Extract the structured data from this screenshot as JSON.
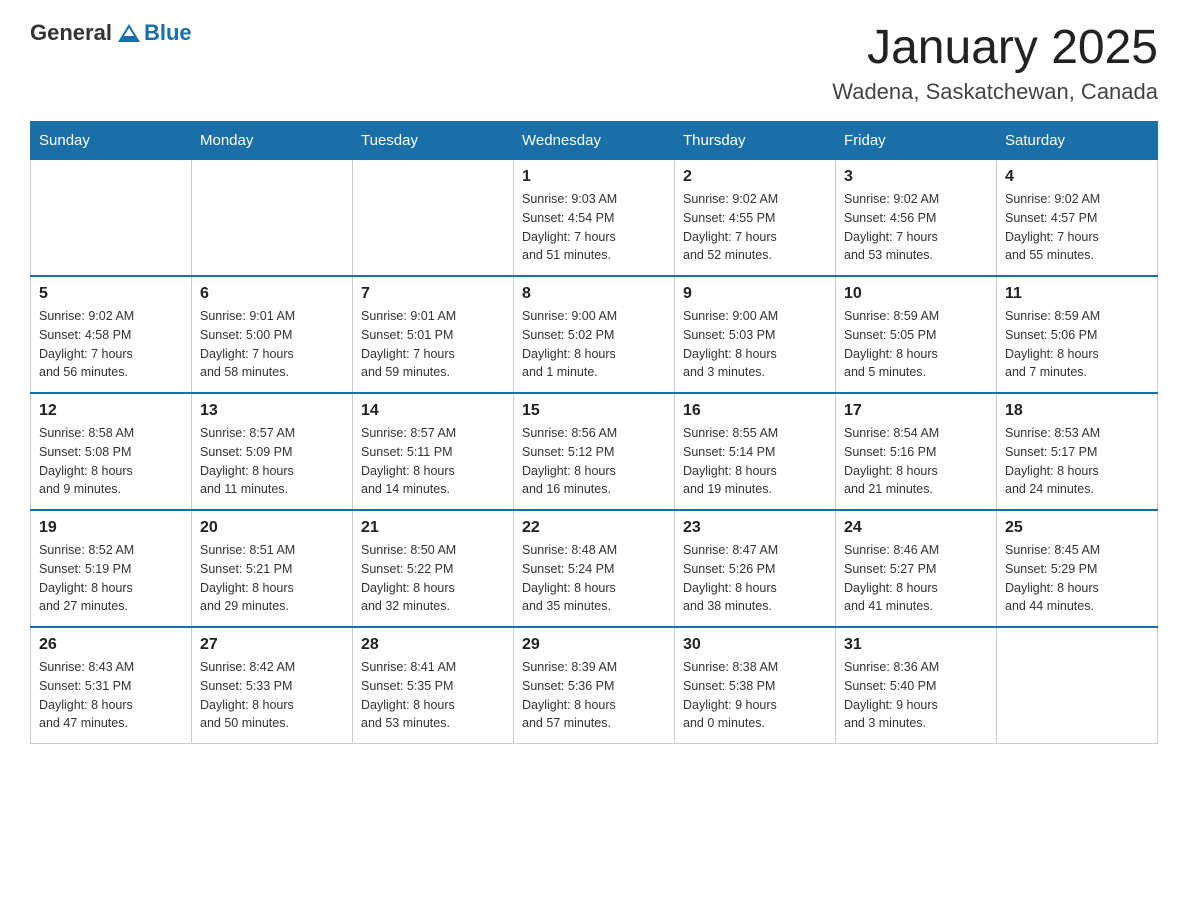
{
  "logo": {
    "general": "General",
    "blue": "Blue"
  },
  "title": "January 2025",
  "subtitle": "Wadena, Saskatchewan, Canada",
  "headers": [
    "Sunday",
    "Monday",
    "Tuesday",
    "Wednesday",
    "Thursday",
    "Friday",
    "Saturday"
  ],
  "weeks": [
    [
      {
        "day": "",
        "info": ""
      },
      {
        "day": "",
        "info": ""
      },
      {
        "day": "",
        "info": ""
      },
      {
        "day": "1",
        "info": "Sunrise: 9:03 AM\nSunset: 4:54 PM\nDaylight: 7 hours\nand 51 minutes."
      },
      {
        "day": "2",
        "info": "Sunrise: 9:02 AM\nSunset: 4:55 PM\nDaylight: 7 hours\nand 52 minutes."
      },
      {
        "day": "3",
        "info": "Sunrise: 9:02 AM\nSunset: 4:56 PM\nDaylight: 7 hours\nand 53 minutes."
      },
      {
        "day": "4",
        "info": "Sunrise: 9:02 AM\nSunset: 4:57 PM\nDaylight: 7 hours\nand 55 minutes."
      }
    ],
    [
      {
        "day": "5",
        "info": "Sunrise: 9:02 AM\nSunset: 4:58 PM\nDaylight: 7 hours\nand 56 minutes."
      },
      {
        "day": "6",
        "info": "Sunrise: 9:01 AM\nSunset: 5:00 PM\nDaylight: 7 hours\nand 58 minutes."
      },
      {
        "day": "7",
        "info": "Sunrise: 9:01 AM\nSunset: 5:01 PM\nDaylight: 7 hours\nand 59 minutes."
      },
      {
        "day": "8",
        "info": "Sunrise: 9:00 AM\nSunset: 5:02 PM\nDaylight: 8 hours\nand 1 minute."
      },
      {
        "day": "9",
        "info": "Sunrise: 9:00 AM\nSunset: 5:03 PM\nDaylight: 8 hours\nand 3 minutes."
      },
      {
        "day": "10",
        "info": "Sunrise: 8:59 AM\nSunset: 5:05 PM\nDaylight: 8 hours\nand 5 minutes."
      },
      {
        "day": "11",
        "info": "Sunrise: 8:59 AM\nSunset: 5:06 PM\nDaylight: 8 hours\nand 7 minutes."
      }
    ],
    [
      {
        "day": "12",
        "info": "Sunrise: 8:58 AM\nSunset: 5:08 PM\nDaylight: 8 hours\nand 9 minutes."
      },
      {
        "day": "13",
        "info": "Sunrise: 8:57 AM\nSunset: 5:09 PM\nDaylight: 8 hours\nand 11 minutes."
      },
      {
        "day": "14",
        "info": "Sunrise: 8:57 AM\nSunset: 5:11 PM\nDaylight: 8 hours\nand 14 minutes."
      },
      {
        "day": "15",
        "info": "Sunrise: 8:56 AM\nSunset: 5:12 PM\nDaylight: 8 hours\nand 16 minutes."
      },
      {
        "day": "16",
        "info": "Sunrise: 8:55 AM\nSunset: 5:14 PM\nDaylight: 8 hours\nand 19 minutes."
      },
      {
        "day": "17",
        "info": "Sunrise: 8:54 AM\nSunset: 5:16 PM\nDaylight: 8 hours\nand 21 minutes."
      },
      {
        "day": "18",
        "info": "Sunrise: 8:53 AM\nSunset: 5:17 PM\nDaylight: 8 hours\nand 24 minutes."
      }
    ],
    [
      {
        "day": "19",
        "info": "Sunrise: 8:52 AM\nSunset: 5:19 PM\nDaylight: 8 hours\nand 27 minutes."
      },
      {
        "day": "20",
        "info": "Sunrise: 8:51 AM\nSunset: 5:21 PM\nDaylight: 8 hours\nand 29 minutes."
      },
      {
        "day": "21",
        "info": "Sunrise: 8:50 AM\nSunset: 5:22 PM\nDaylight: 8 hours\nand 32 minutes."
      },
      {
        "day": "22",
        "info": "Sunrise: 8:48 AM\nSunset: 5:24 PM\nDaylight: 8 hours\nand 35 minutes."
      },
      {
        "day": "23",
        "info": "Sunrise: 8:47 AM\nSunset: 5:26 PM\nDaylight: 8 hours\nand 38 minutes."
      },
      {
        "day": "24",
        "info": "Sunrise: 8:46 AM\nSunset: 5:27 PM\nDaylight: 8 hours\nand 41 minutes."
      },
      {
        "day": "25",
        "info": "Sunrise: 8:45 AM\nSunset: 5:29 PM\nDaylight: 8 hours\nand 44 minutes."
      }
    ],
    [
      {
        "day": "26",
        "info": "Sunrise: 8:43 AM\nSunset: 5:31 PM\nDaylight: 8 hours\nand 47 minutes."
      },
      {
        "day": "27",
        "info": "Sunrise: 8:42 AM\nSunset: 5:33 PM\nDaylight: 8 hours\nand 50 minutes."
      },
      {
        "day": "28",
        "info": "Sunrise: 8:41 AM\nSunset: 5:35 PM\nDaylight: 8 hours\nand 53 minutes."
      },
      {
        "day": "29",
        "info": "Sunrise: 8:39 AM\nSunset: 5:36 PM\nDaylight: 8 hours\nand 57 minutes."
      },
      {
        "day": "30",
        "info": "Sunrise: 8:38 AM\nSunset: 5:38 PM\nDaylight: 9 hours\nand 0 minutes."
      },
      {
        "day": "31",
        "info": "Sunrise: 8:36 AM\nSunset: 5:40 PM\nDaylight: 9 hours\nand 3 minutes."
      },
      {
        "day": "",
        "info": ""
      }
    ]
  ]
}
